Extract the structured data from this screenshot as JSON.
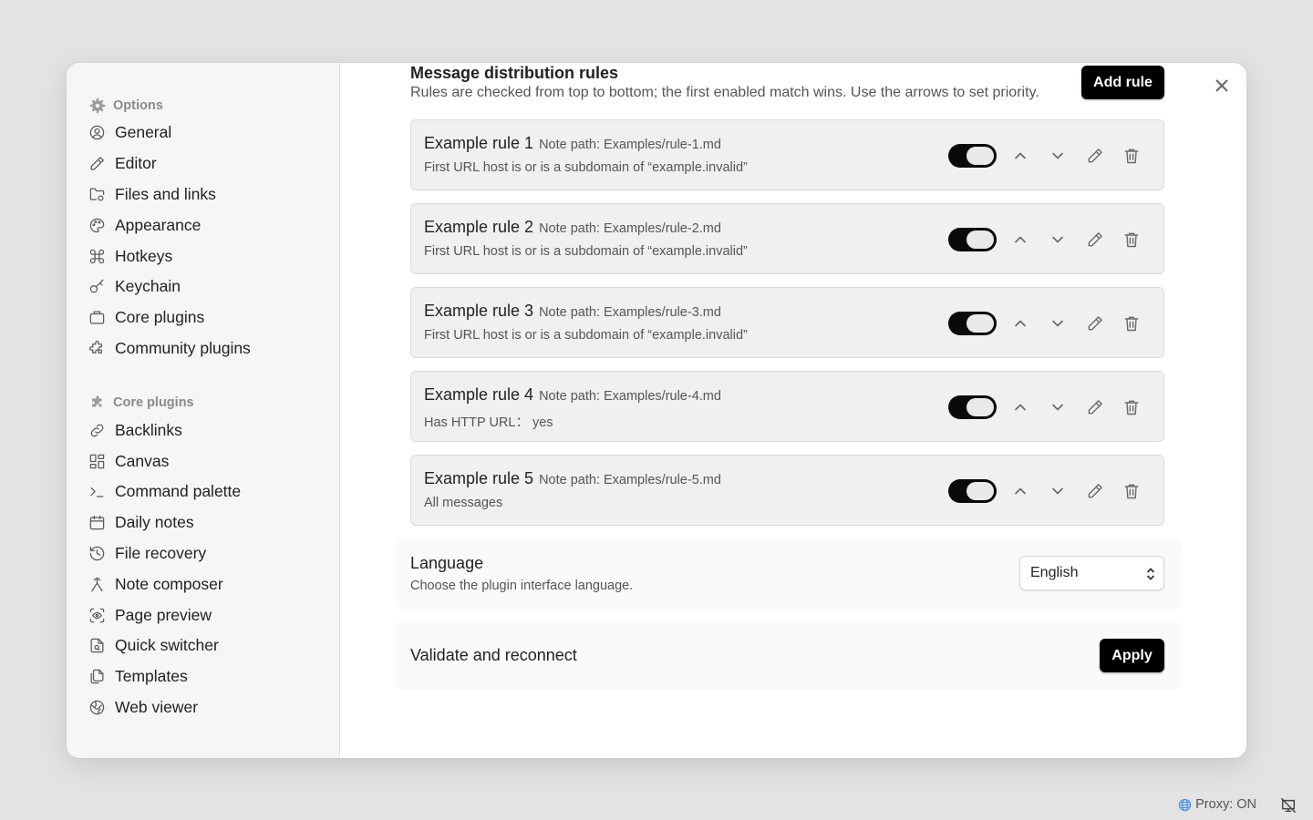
{
  "sidebar": {
    "options_title": "Options",
    "options_items": [
      {
        "label": "General",
        "icon": "user-circle-icon"
      },
      {
        "label": "Editor",
        "icon": "pencil-icon"
      },
      {
        "label": "Files and links",
        "icon": "folder-cog-icon"
      },
      {
        "label": "Appearance",
        "icon": "palette-icon"
      },
      {
        "label": "Hotkeys",
        "icon": "command-icon"
      },
      {
        "label": "Keychain",
        "icon": "key-icon"
      },
      {
        "label": "Core plugins",
        "icon": "briefcase-icon"
      },
      {
        "label": "Community plugins",
        "icon": "puzzle-icon"
      }
    ],
    "core_title": "Core plugins",
    "core_items": [
      {
        "label": "Backlinks",
        "icon": "link-icon"
      },
      {
        "label": "Canvas",
        "icon": "layout-dashboard-icon"
      },
      {
        "label": "Command palette",
        "icon": "terminal-icon"
      },
      {
        "label": "Daily notes",
        "icon": "calendar-icon"
      },
      {
        "label": "File recovery",
        "icon": "history-icon"
      },
      {
        "label": "Note composer",
        "icon": "merge-icon"
      },
      {
        "label": "Page preview",
        "icon": "scan-eye-icon"
      },
      {
        "label": "Quick switcher",
        "icon": "file-search-icon"
      },
      {
        "label": "Templates",
        "icon": "files-icon"
      },
      {
        "label": "Web viewer",
        "icon": "globe-icon"
      }
    ]
  },
  "header": {
    "title": "Message distribution rules",
    "description": "Rules are checked from top to bottom; the first enabled match wins. Use the arrows to set priority.",
    "add_rule_label": "Add rule"
  },
  "rules": [
    {
      "name": "Example rule 1",
      "path": "Note path: Examples/rule-1.md",
      "condition": "First URL host is or is a subdomain of “example.invalid”",
      "enabled": true
    },
    {
      "name": "Example rule 2",
      "path": "Note path: Examples/rule-2.md",
      "condition": "First URL host is or is a subdomain of “example.invalid”",
      "enabled": true
    },
    {
      "name": "Example rule 3",
      "path": "Note path: Examples/rule-3.md",
      "condition": "First URL host is or is a subdomain of “example.invalid”",
      "enabled": true
    },
    {
      "name": "Example rule 4",
      "path": "Note path: Examples/rule-4.md",
      "condition": "Has HTTP URL： yes",
      "enabled": true
    },
    {
      "name": "Example rule 5",
      "path": "Note path: Examples/rule-5.md",
      "condition": "All messages",
      "enabled": true
    }
  ],
  "language": {
    "title": "Language",
    "description": "Choose the plugin interface language.",
    "selected": "English"
  },
  "validate": {
    "title": "Validate and reconnect",
    "apply_label": "Apply"
  },
  "statusbar": {
    "proxy_text": "Proxy: ON"
  },
  "colors": {
    "accent": "#000000",
    "toggle_on": "#0a0a0a"
  }
}
